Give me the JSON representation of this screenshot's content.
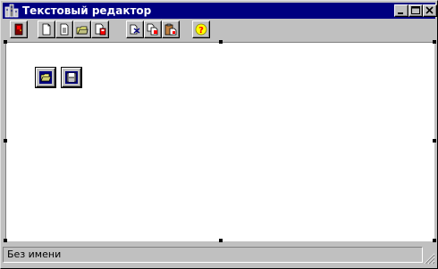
{
  "window": {
    "title": "Текстовый редактор",
    "title_icon": "app-building-icon",
    "controls": [
      "minimize-icon",
      "maximize-icon",
      "close-icon"
    ]
  },
  "toolbar": {
    "buttons": [
      {
        "icon": "exit-door-icon"
      },
      {
        "icon": "new-document-icon"
      },
      {
        "icon": "document-icon"
      },
      {
        "icon": "open-folder-document-icon"
      },
      {
        "icon": "save-document-icon"
      },
      {
        "icon": "cut-icon"
      },
      {
        "icon": "copy-icon"
      },
      {
        "icon": "paste-icon"
      },
      {
        "icon": "help-icon"
      }
    ]
  },
  "editor": {
    "buttons": [
      {
        "icon": "open-folder-icon"
      },
      {
        "icon": "save-floppy-icon"
      }
    ]
  },
  "statusbar": {
    "text": "Без имени"
  },
  "colors": {
    "titlebar": "#000080",
    "face": "#c0c0c0",
    "editor_bg": "#ffffff"
  }
}
